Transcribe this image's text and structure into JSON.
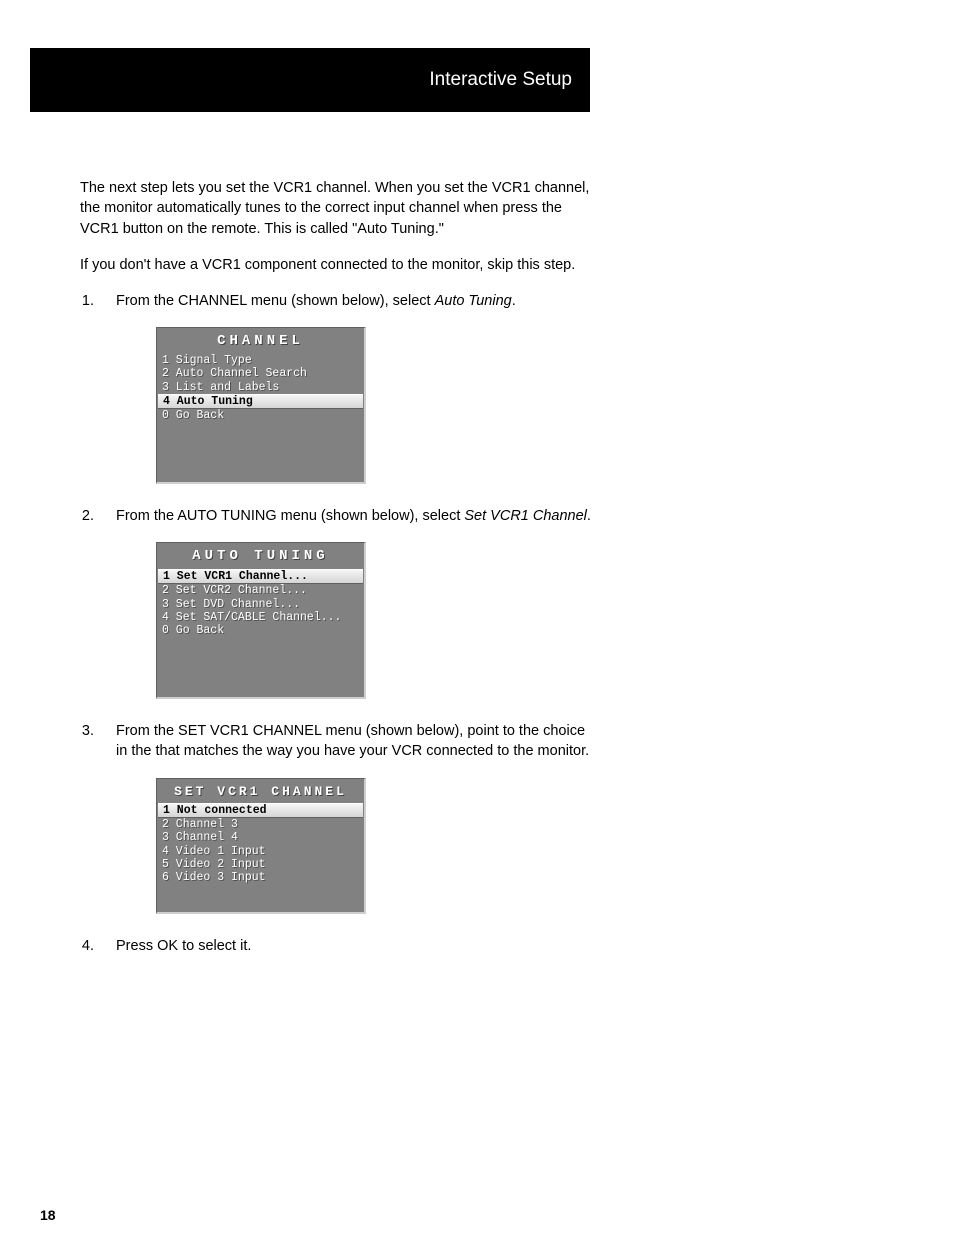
{
  "header_bar": "Interactive Setup",
  "page_number": "18",
  "intro_para": "The next step lets you set the VCR1 channel. When you set the VCR1 channel, the monitor automatically tunes to the correct input channel when press the VCR1 button on the remote. This is called \"Auto Tuning.\"",
  "skip_para": "If you don't have a VCR1 component connected to the monitor, skip this step.",
  "steps": {
    "s1_a": "From the CHANNEL menu (shown below), select ",
    "s1_b": "Auto Tuning",
    "s1_c": ".",
    "s2_a": "From the AUTO TUNING menu (shown below), select ",
    "s2_b": "Set VCR1 Channel",
    "s2_c": ".",
    "s3": "From the SET VCR1 CHANNEL menu (shown below), point to the choice in the that matches the way you have your VCR connected to the monitor.",
    "s4": "Press OK to select it."
  },
  "osd1": {
    "title": "CHANNEL",
    "items": [
      {
        "n": "1",
        "t": "Signal Type",
        "sel": false
      },
      {
        "n": "2",
        "t": "Auto Channel Search",
        "sel": false
      },
      {
        "n": "3",
        "t": "List and Labels",
        "sel": false
      },
      {
        "n": "4",
        "t": "Auto Tuning",
        "sel": true
      },
      {
        "n": "0",
        "t": "Go Back",
        "sel": false
      }
    ]
  },
  "osd2": {
    "title": "AUTO TUNING",
    "items": [
      {
        "n": "1",
        "t": "Set VCR1 Channel...",
        "sel": true
      },
      {
        "n": "2",
        "t": "Set VCR2 Channel...",
        "sel": false
      },
      {
        "n": "3",
        "t": "Set DVD Channel...",
        "sel": false
      },
      {
        "n": "4",
        "t": "Set SAT/CABLE Channel...",
        "sel": false
      },
      {
        "n": "0",
        "t": "Go Back",
        "sel": false
      }
    ]
  },
  "osd3": {
    "title": "SET VCR1 CHANNEL",
    "items": [
      {
        "n": "1",
        "t": "Not connected",
        "sel": true
      },
      {
        "n": "2",
        "t": "Channel 3",
        "sel": false
      },
      {
        "n": "3",
        "t": "Channel 4",
        "sel": false
      },
      {
        "n": "4",
        "t": "Video 1 Input",
        "sel": false
      },
      {
        "n": "5",
        "t": "Video 2 Input",
        "sel": false
      },
      {
        "n": "6",
        "t": "Video 3 Input",
        "sel": false
      }
    ]
  }
}
